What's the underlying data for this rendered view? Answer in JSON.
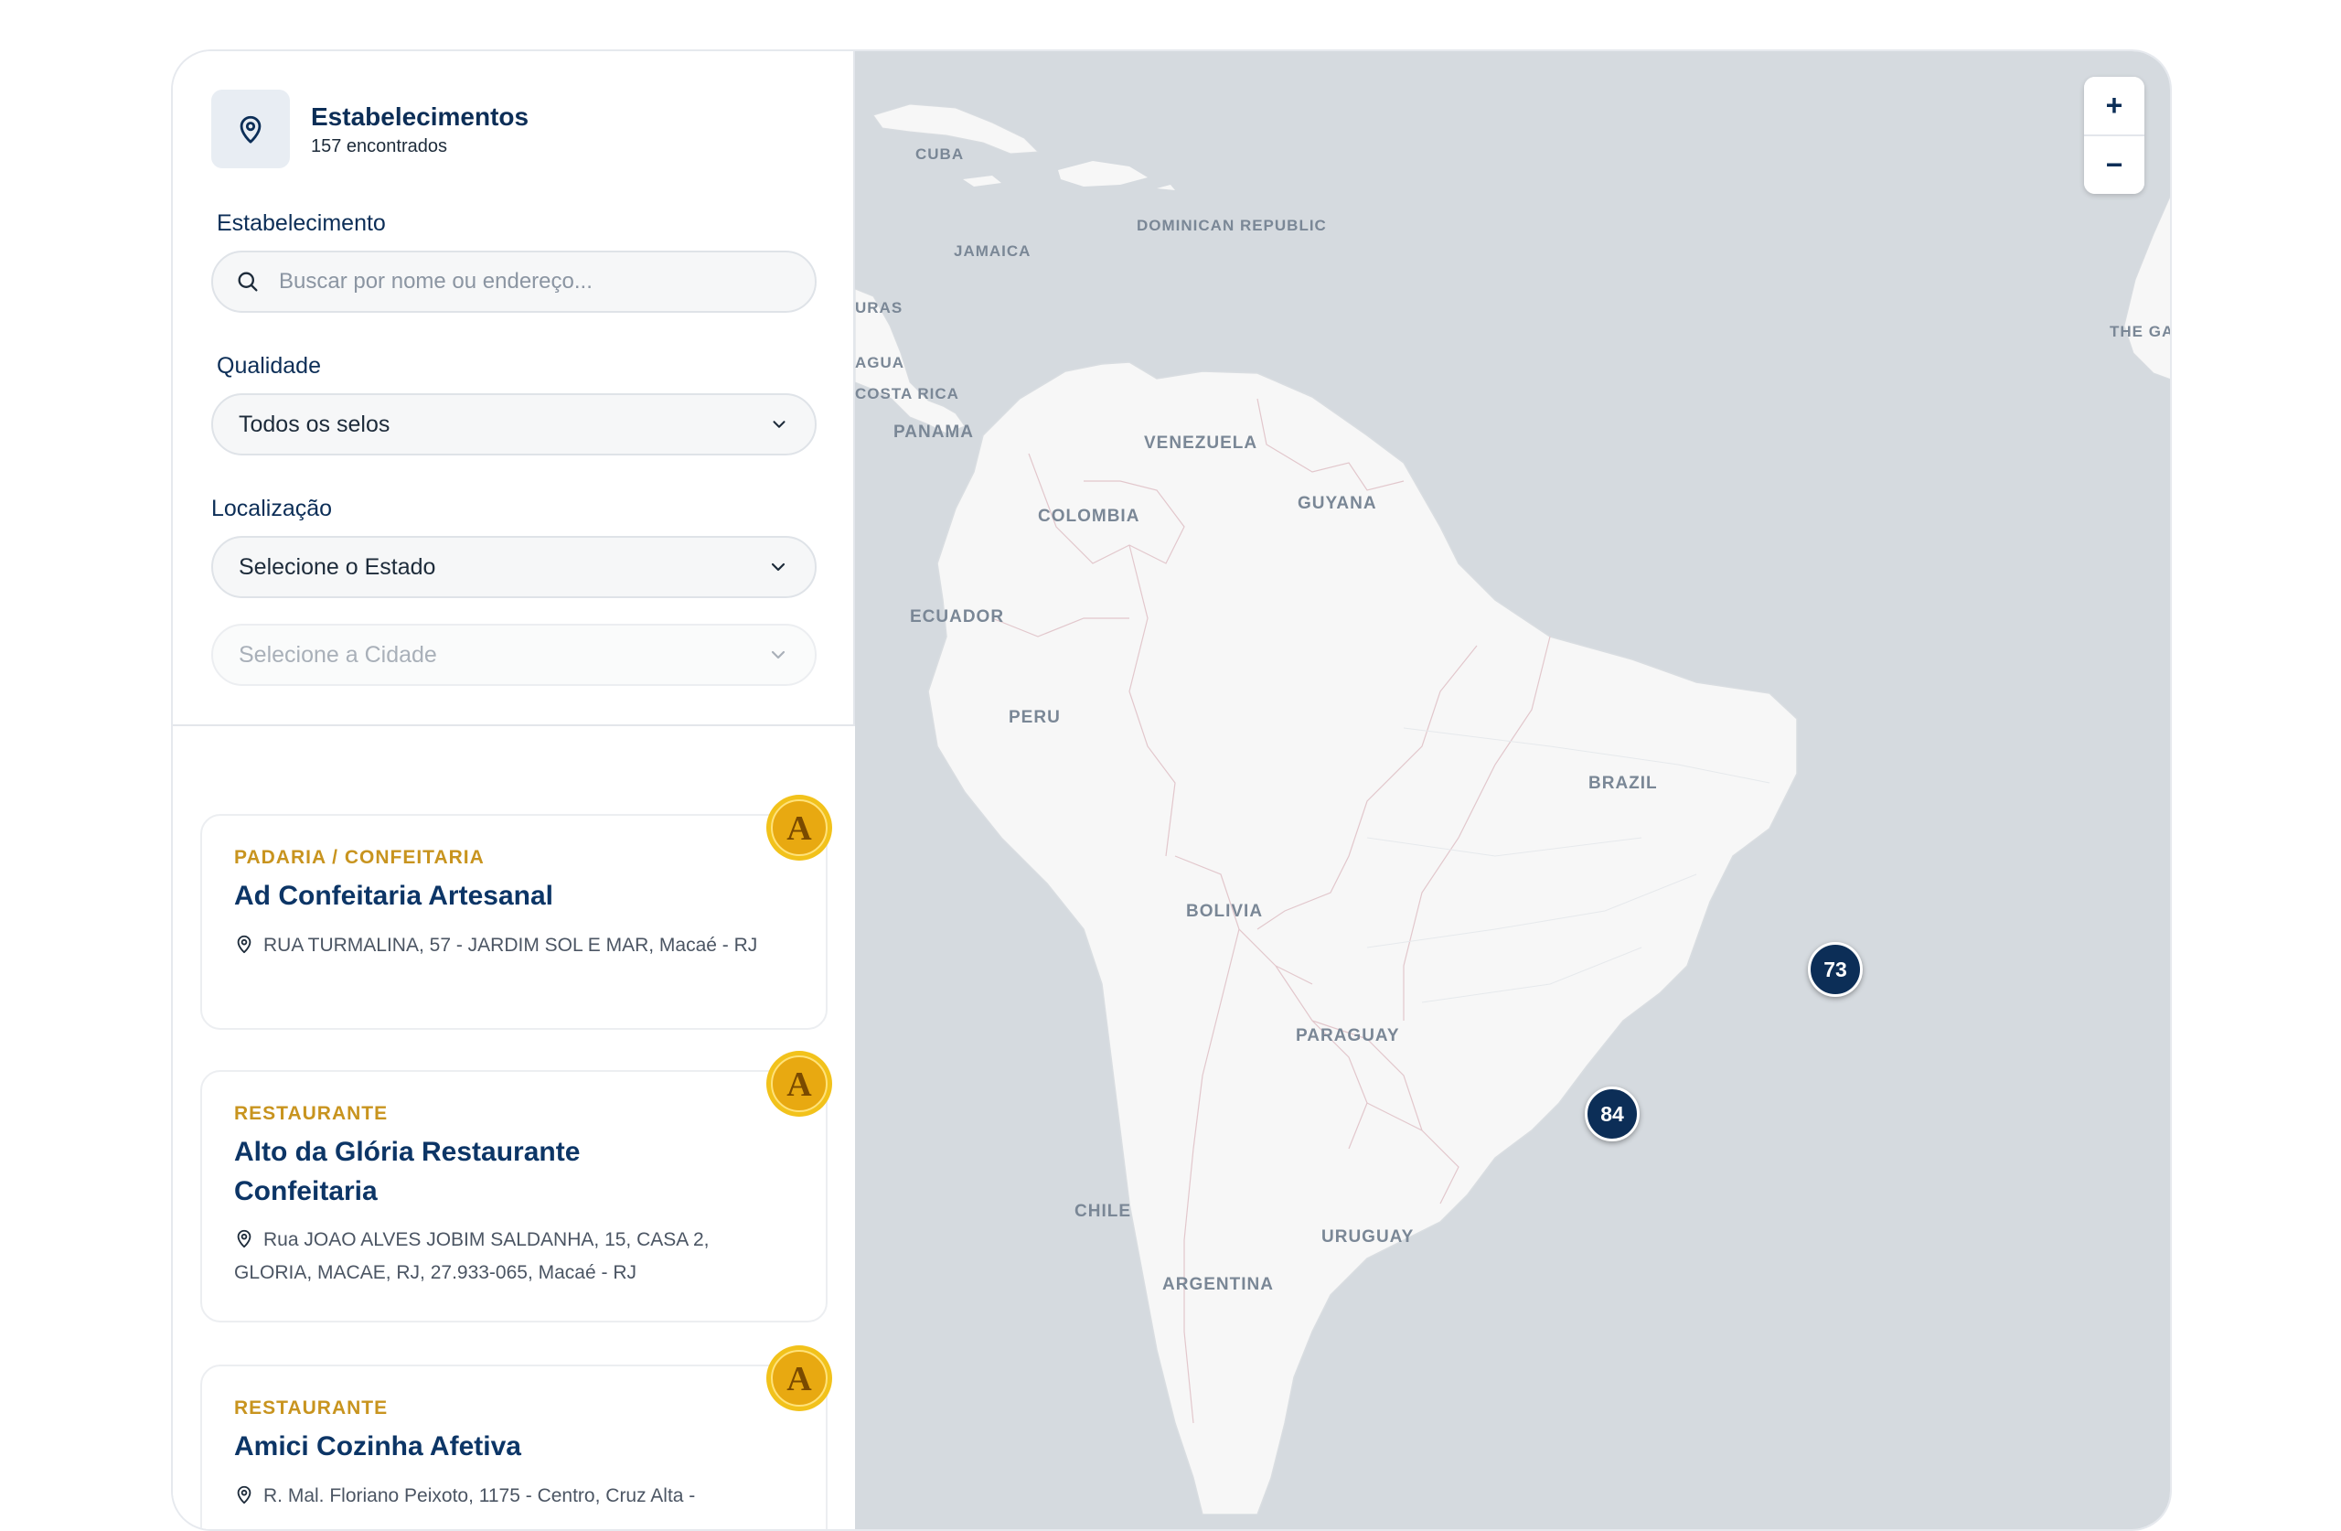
{
  "sidebar": {
    "title": "Estabelecimentos",
    "count": "157 encontrados",
    "search": {
      "label": "Estabelecimento",
      "placeholder": "Buscar por nome ou endereço..."
    },
    "quality": {
      "label": "Qualidade",
      "value": "Todos os selos"
    },
    "location": {
      "label": "Localização",
      "state_value": "Selecione o Estado",
      "city_value": "Selecione a Cidade"
    }
  },
  "establishments": [
    {
      "category": "PADARIA / CONFEITARIA",
      "name": "Ad Confeitaria Artesanal",
      "address": "RUA TURMALINA, 57 - JARDIM SOL E MAR, Macaé - RJ",
      "badge": "A"
    },
    {
      "category": "RESTAURANTE",
      "name": "Alto da Glória Restaurante Confeitaria",
      "address": "Rua JOAO ALVES JOBIM SALDANHA, 15, CASA 2, GLORIA, MACAE, RJ, 27.933-065, Macaé - RJ",
      "badge": "A"
    },
    {
      "category": "RESTAURANTE",
      "name": "Amici Cozinha Afetiva",
      "address": "R. Mal. Floriano Peixoto, 1175 - Centro, Cruz Alta -",
      "badge": "A"
    }
  ],
  "map": {
    "zoom_in": "+",
    "zoom_out": "−",
    "labels": {
      "cuba": "CUBA",
      "jamaica": "JAMAICA",
      "dominican": "DOMINICAN REPUBLIC",
      "honduras": "URAS",
      "nicaragua": "AGUA",
      "costa_rica": "COSTA RICA",
      "panama": "PANAMA",
      "venezuela": "VENEZUELA",
      "guyana": "GUYANA",
      "colombia": "COLOMBIA",
      "ecuador": "ECUADOR",
      "peru": "PERU",
      "brazil": "BRAZIL",
      "bolivia": "BOLIVIA",
      "paraguay": "PARAGUAY",
      "chile": "CHILE",
      "uruguay": "URUGUAY",
      "argentina": "ARGENTINA",
      "gambia": "THE GAMB GUINE BISSA"
    },
    "clusters": [
      {
        "count": "73"
      },
      {
        "count": "84"
      }
    ]
  },
  "colors": {
    "navy": "#0c2e57",
    "gold": "#c8941f",
    "map_water": "#d5dadf",
    "land": "#f7f7f7"
  }
}
